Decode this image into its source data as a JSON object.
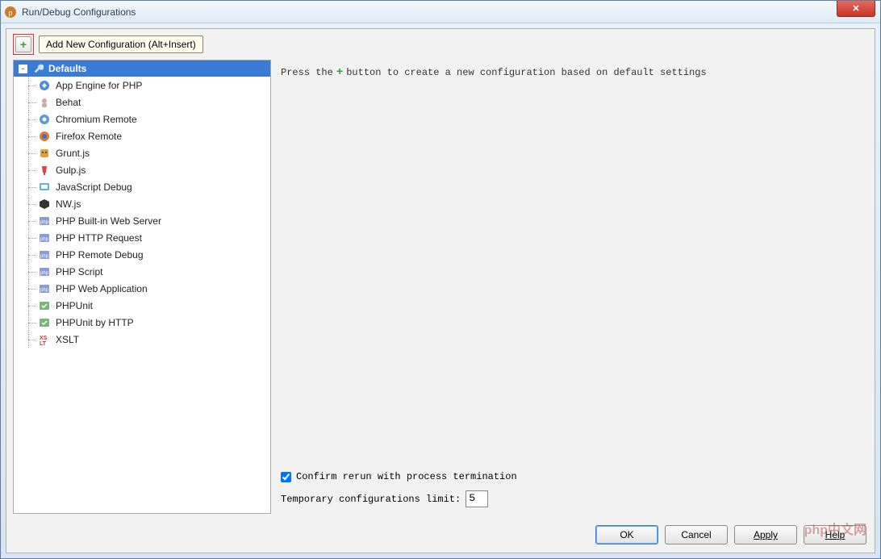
{
  "window": {
    "title": "Run/Debug Configurations"
  },
  "toolbar": {
    "add_tooltip": "Add New Configuration (Alt+Insert)"
  },
  "tree": {
    "root_label": "Defaults",
    "items": [
      {
        "label": "App Engine for PHP",
        "icon": "appengine"
      },
      {
        "label": "Behat",
        "icon": "behat"
      },
      {
        "label": "Chromium Remote",
        "icon": "chromium"
      },
      {
        "label": "Firefox Remote",
        "icon": "firefox"
      },
      {
        "label": "Grunt.js",
        "icon": "grunt"
      },
      {
        "label": "Gulp.js",
        "icon": "gulp"
      },
      {
        "label": "JavaScript Debug",
        "icon": "jsdebug"
      },
      {
        "label": "NW.js",
        "icon": "nwjs"
      },
      {
        "label": "PHP Built-in Web Server",
        "icon": "php"
      },
      {
        "label": "PHP HTTP Request",
        "icon": "php"
      },
      {
        "label": "PHP Remote Debug",
        "icon": "php"
      },
      {
        "label": "PHP Script",
        "icon": "php"
      },
      {
        "label": "PHP Web Application",
        "icon": "php"
      },
      {
        "label": "PHPUnit",
        "icon": "phpunit"
      },
      {
        "label": "PHPUnit by HTTP",
        "icon": "phpunit"
      },
      {
        "label": "XSLT",
        "icon": "xslt"
      }
    ]
  },
  "hint": {
    "prefix": "Press the",
    "suffix": "button to create a new configuration based on default settings"
  },
  "options": {
    "confirm_rerun_label": "Confirm rerun with process termination",
    "confirm_rerun_checked": true,
    "temp_limit_label": "Temporary configurations limit:",
    "temp_limit_value": "5"
  },
  "buttons": {
    "ok": "OK",
    "cancel": "Cancel",
    "apply": "Apply",
    "help": "Help"
  },
  "watermark": "php中文网"
}
